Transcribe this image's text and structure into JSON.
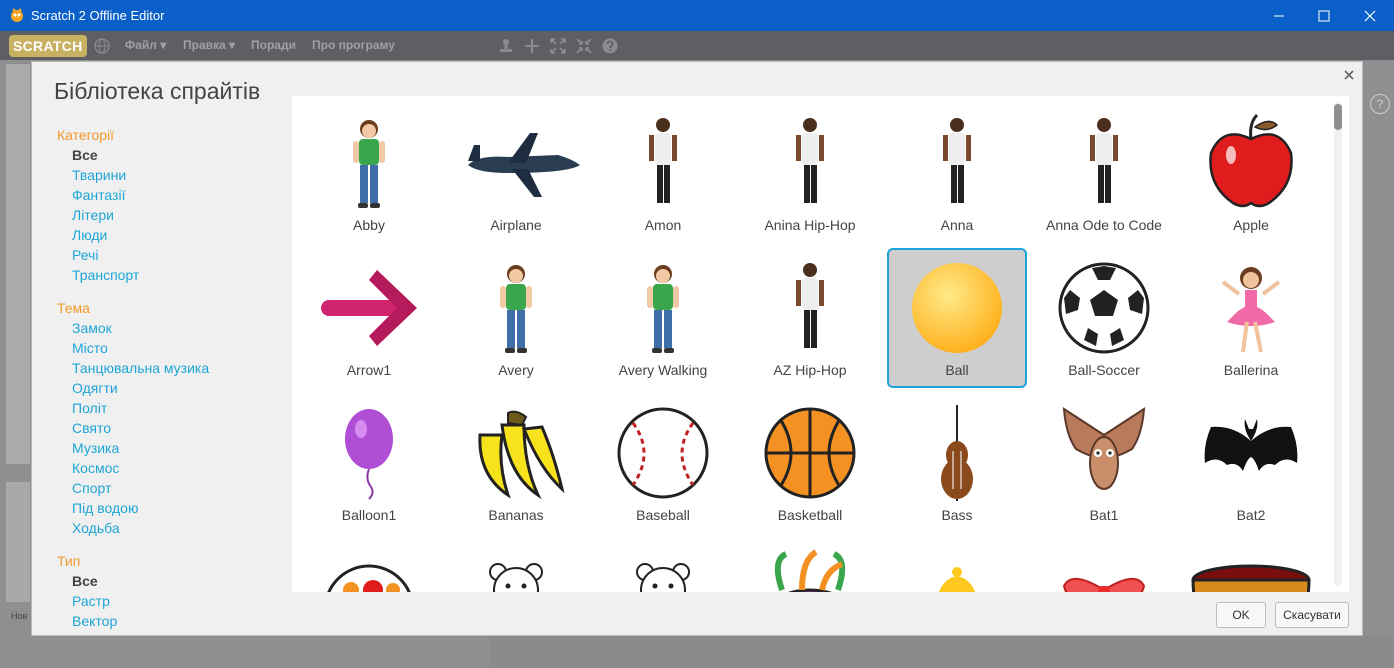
{
  "window": {
    "title": "Scratch 2 Offline Editor"
  },
  "menu": {
    "logo": "SCRATCH",
    "items": [
      {
        "label": "Файл ▾"
      },
      {
        "label": "Правка ▾"
      },
      {
        "label": "Поради"
      },
      {
        "label": "Про програму"
      }
    ]
  },
  "background": {
    "label": "Нов"
  },
  "dialog": {
    "title": "Бібліотека спрайтів",
    "categories": {
      "heading": "Категорії",
      "items": [
        "Все",
        "Тварини",
        "Фантазії",
        "Літери",
        "Люди",
        "Речі",
        "Транспорт"
      ],
      "selected": "Все"
    },
    "themes": {
      "heading": "Тема",
      "items": [
        "Замок",
        "Місто",
        "Танцювальна музика",
        "Одягти",
        "Політ",
        "Свято",
        "Музика",
        "Космос",
        "Спорт",
        "Під водою",
        "Ходьба"
      ]
    },
    "types": {
      "heading": "Тип",
      "items": [
        "Все",
        "Растр",
        "Вектор"
      ],
      "selected": "Все"
    },
    "sprites": [
      {
        "name": "Abby",
        "icon": "girl-sprite"
      },
      {
        "name": "Airplane",
        "icon": "airplane-sprite"
      },
      {
        "name": "Amon",
        "icon": "dancer-sprite"
      },
      {
        "name": "Anina Hip-Hop",
        "icon": "dancer-sprite"
      },
      {
        "name": "Anna",
        "icon": "dancer-sprite"
      },
      {
        "name": "Anna Ode to Code",
        "icon": "dancer-sprite"
      },
      {
        "name": "Apple",
        "icon": "apple-sprite"
      },
      {
        "name": "Arrow1",
        "icon": "arrow-sprite"
      },
      {
        "name": "Avery",
        "icon": "girl-sprite"
      },
      {
        "name": "Avery Walking",
        "icon": "girl-sprite"
      },
      {
        "name": "AZ Hip-Hop",
        "icon": "dancer-sprite"
      },
      {
        "name": "Ball",
        "icon": "ball-sprite",
        "selected": true
      },
      {
        "name": "Ball-Soccer",
        "icon": "soccer-ball-sprite"
      },
      {
        "name": "Ballerina",
        "icon": "ballerina-sprite"
      },
      {
        "name": "Balloon1",
        "icon": "balloon-sprite"
      },
      {
        "name": "Bananas",
        "icon": "bananas-sprite"
      },
      {
        "name": "Baseball",
        "icon": "baseball-sprite"
      },
      {
        "name": "Basketball",
        "icon": "basketball-sprite"
      },
      {
        "name": "Bass",
        "icon": "bass-sprite"
      },
      {
        "name": "Bat1",
        "icon": "bat-sprite"
      },
      {
        "name": "Bat2",
        "icon": "bat-silhouette-sprite"
      },
      {
        "name": "",
        "icon": "plate-sprite"
      },
      {
        "name": "",
        "icon": "bear-sprite"
      },
      {
        "name": "",
        "icon": "bear-sprite"
      },
      {
        "name": "",
        "icon": "beetle-sprite"
      },
      {
        "name": "",
        "icon": "bell-sprite"
      },
      {
        "name": "",
        "icon": "bow-sprite"
      },
      {
        "name": "",
        "icon": "bowl-sprite"
      }
    ],
    "ok_label": "OK",
    "cancel_label": "Скасувати"
  },
  "colors": {
    "titlebar": "#0a60c8",
    "selection": "#1fa3db",
    "link": "#1ea6d8",
    "heading": "#f29b2c"
  }
}
